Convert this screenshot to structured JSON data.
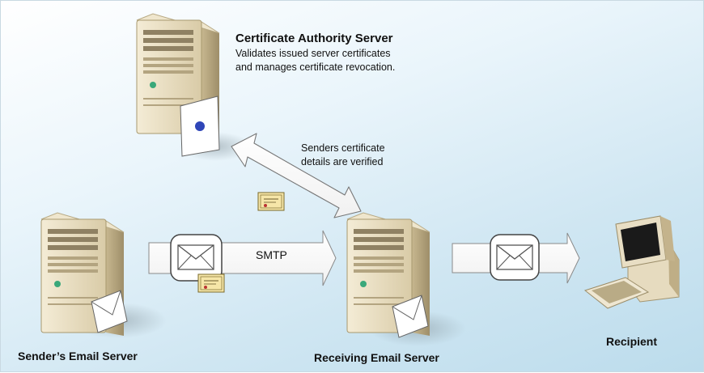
{
  "ca_server": {
    "title": "Certificate Authority Server",
    "desc_line1": "Validates issued server certificates",
    "desc_line2": "and manages certificate revocation."
  },
  "verification": {
    "line1": "Senders certificate",
    "line2": "details are verified"
  },
  "smtp_label": "SMTP",
  "sender_server": {
    "label": "Sender’s Email Server"
  },
  "receiving_server": {
    "label": "Receiving Email Server"
  },
  "recipient": {
    "label": "Recipient"
  },
  "colors": {
    "arrow_fill": "#ffffff",
    "server_body": "#e7dcc2",
    "server_shadow": "#b5a889",
    "background": "#d4e9f3"
  },
  "icons": [
    "server-icon",
    "envelope-icon",
    "certificate-icon",
    "desktop-computer-icon"
  ]
}
